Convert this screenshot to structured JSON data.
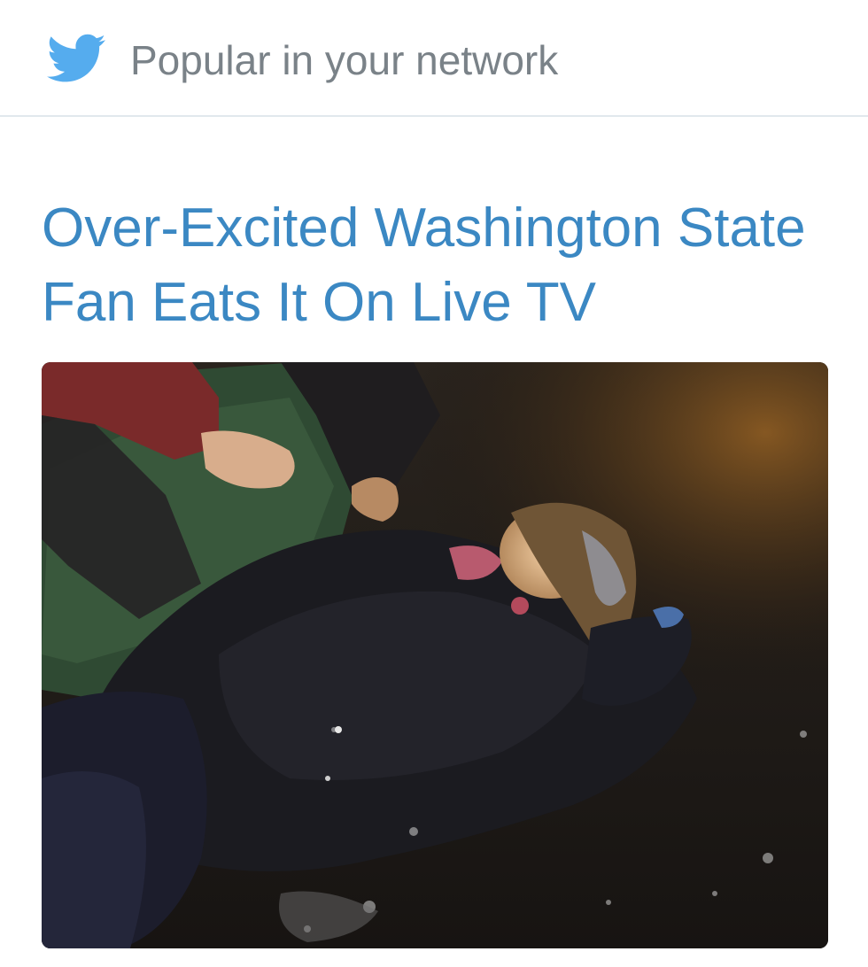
{
  "card": {
    "header": {
      "icon": "twitter-bird-icon",
      "label": "Popular in your network"
    },
    "headline": "Over-Excited Washington State Fan Eats It On Live TV",
    "thumbnail": {
      "type": "video-still"
    }
  },
  "colors": {
    "brand_blue": "#55acee",
    "headline_blue": "#3b88c3",
    "header_text": "#7a8288",
    "divider": "#e1e8ed"
  }
}
